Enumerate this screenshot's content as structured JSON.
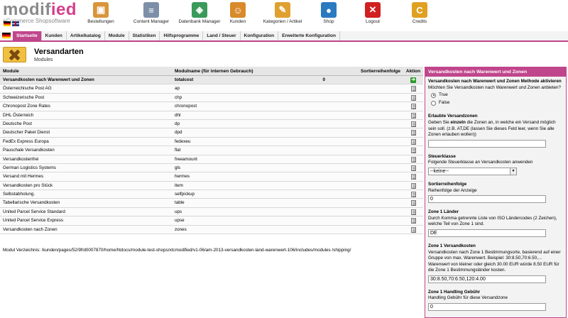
{
  "brand": {
    "logo_main": "modif",
    "logo_accent": "ied",
    "tagline": "eCommerce Shopsoftware"
  },
  "topnav": [
    {
      "label": "Bestellungen",
      "icon": "box-icon",
      "color": "#d9953a"
    },
    {
      "label": "Content Manager",
      "icon": "document-icon",
      "color": "#7d8fa8"
    },
    {
      "label": "Datenbank Manager",
      "icon": "database-icon",
      "color": "#3a9a5a"
    },
    {
      "label": "Kunden",
      "icon": "users-icon",
      "color": "#d98a2a"
    },
    {
      "label": "Kategorien / Artikel",
      "icon": "categories-icon",
      "color": "#e0a030"
    },
    {
      "label": "Shop",
      "icon": "globe-icon",
      "color": "#2a7ac0"
    },
    {
      "label": "Logout",
      "icon": "close-icon",
      "color": "#d02020"
    },
    {
      "label": "Credits",
      "icon": "credits-icon",
      "color": "#e0a020"
    }
  ],
  "tabs": [
    "Startseite",
    "Kunden",
    "Artikelkatalog",
    "Module",
    "Statistiken",
    "Hilfsprogramme",
    "Land / Steuer",
    "Konfiguration",
    "Erweiterte Konfiguration"
  ],
  "page": {
    "title": "Versandarten",
    "subtitle": "Modules"
  },
  "table": {
    "headers": [
      "Module",
      "Modulname (für internen Gebrauch)",
      "Sortierreihenfolge",
      "Aktion"
    ],
    "rows": [
      {
        "module": "Versandkosten nach Warenwert und Zonen",
        "code": "totalcost",
        "sort": "0",
        "selected": true
      },
      {
        "module": "Österreichische Post AG",
        "code": "ap",
        "sort": ""
      },
      {
        "module": "Schweizerische Post",
        "code": "chp",
        "sort": ""
      },
      {
        "module": "Chronopost Zone Rates",
        "code": "chronopost",
        "sort": ""
      },
      {
        "module": "DHL Österreich",
        "code": "dhl",
        "sort": ""
      },
      {
        "module": "Deutsche Post",
        "code": "dp",
        "sort": ""
      },
      {
        "module": "Deutscher Paket Dienst",
        "code": "dpd",
        "sort": ""
      },
      {
        "module": "FedEx Express Europa",
        "code": "fedexeu",
        "sort": ""
      },
      {
        "module": "Pauschale Versandkosten",
        "code": "flat",
        "sort": ""
      },
      {
        "module": "Versandkostenfrei",
        "code": "freeamount",
        "sort": ""
      },
      {
        "module": "German Logistics Systems",
        "code": "gls",
        "sort": ""
      },
      {
        "module": "Versand mit Hermes",
        "code": "hermes",
        "sort": ""
      },
      {
        "module": "Versandkosten pro Stück",
        "code": "item",
        "sort": ""
      },
      {
        "module": "Selbstabholung.",
        "code": "selfpickup",
        "sort": ""
      },
      {
        "module": "Tabellarische Versandkosten",
        "code": "table",
        "sort": ""
      },
      {
        "module": "United Parcel Service Standard",
        "code": "ups",
        "sort": ""
      },
      {
        "module": "United Parcel Service Express",
        "code": "upse",
        "sort": ""
      },
      {
        "module": "Versandkosten nach Zonen",
        "code": "zones",
        "sort": ""
      }
    ]
  },
  "module_dir": "Modul Verzeichnis: /kunden/pages/52/9f/d0007870/home/htdocs/module-test-shops/xtcmodified/v1-06/am-2013-versandkosten-land-warenwert-106/includes/modules /shipping/",
  "panel": {
    "title": "Versandkosten nach Warenwert und Zonen",
    "activate_title": "Versandkosten nach Warenwert und Zonen Methode aktivieren",
    "activate_desc": "Möchten Sie Versandkosten nach Warenwert und Zonen anbieten?",
    "true_label": "True",
    "false_label": "False",
    "zones_title": "Erlaubte Versandzonen",
    "zones_desc_pre": "Geben Sie ",
    "zones_desc_bold": "einzeln",
    "zones_desc_post": " die Zonen an, in welche ein Versand möglich sein soll. (z.B. AT,DE (lassen Sie dieses Feld leer, wenn Sie alle Zonen erlauben wollen))",
    "zones_value": "",
    "tax_title": "Steuerklasse",
    "tax_desc": "Folgende Steuerklasse an Versandkosten anwenden",
    "tax_value": "--keine--",
    "sort_title": "Sortierreihenfolge",
    "sort_desc": "Reihenfolge der Anzeige",
    "sort_value": "0",
    "z1_title": "Zone 1 Länder",
    "z1_desc": "Durch Komma getrennte Liste von ISO Ländercodes (2 Zeichen), welche Teil von Zone 1 sind.",
    "z1_value": "DE",
    "z1c_title": "Zone 1 Versandkosten",
    "z1c_desc": "Versandkosten nach Zone 1 Bestimmungsorte, basierend auf einer Gruppe von max. Warenwert. Beispiel: 30:8.50,70:6.50,... Warenwert von kleiner oder gleich 30.00 EUR würde 8.50 EUR für die Zone 1 Bestimmungsländer kosten.",
    "z1c_value": "30:8.50,70:6.50,120:4.00",
    "z1h_title": "Zone 1 Handling Gebühr",
    "z1h_desc": "Handling Gebühr für diese Versandzone",
    "z1h_value": "0"
  }
}
